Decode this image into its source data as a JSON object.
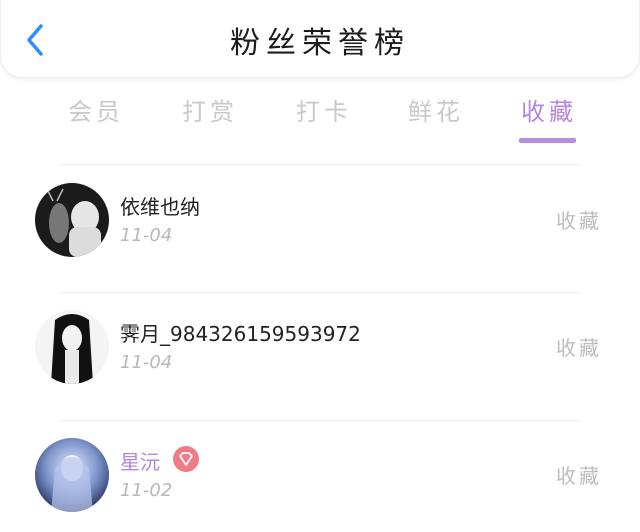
{
  "header": {
    "title": "粉丝荣誉榜",
    "back_icon": "chevron-left-icon"
  },
  "tabs": [
    {
      "label": "会员",
      "active": false
    },
    {
      "label": "打赏",
      "active": false
    },
    {
      "label": "打卡",
      "active": false
    },
    {
      "label": "鲜花",
      "active": false
    },
    {
      "label": "收藏",
      "active": true
    }
  ],
  "colors": {
    "accent": "#b287dc",
    "back_arrow": "#2f8cff",
    "badge": "#f07a86"
  },
  "rows": [
    {
      "name": "依维也纳",
      "date": "11-04",
      "action": "收藏",
      "vip": false
    },
    {
      "name": "霁月_984326159593972",
      "date": "11-04",
      "action": "收藏",
      "vip": false
    },
    {
      "name": "星沅",
      "date": "11-02",
      "action": "收藏",
      "vip": true,
      "badge_icon": "diamond-badge-icon"
    }
  ]
}
